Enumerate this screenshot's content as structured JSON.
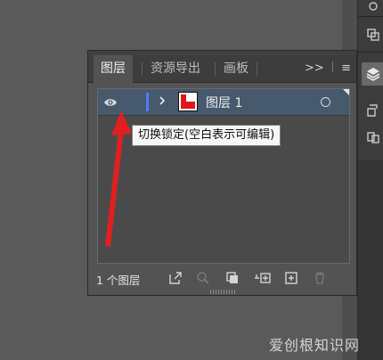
{
  "panel": {
    "tabs": [
      {
        "label": "图层"
      },
      {
        "label": "资源导出"
      },
      {
        "label": "画板"
      }
    ],
    "more_label": ">>",
    "menu_icon": "hamburger-menu-icon"
  },
  "layers": [
    {
      "name": "图层 1",
      "visible": true
    }
  ],
  "tooltip": {
    "text": "切换锁定(空白表示可编辑)"
  },
  "footer": {
    "count_label": "1 个图层"
  },
  "watermark": {
    "text": "爱创根知识网"
  },
  "colors": {
    "layer_color": "#4f7bff",
    "selected_row": "#46596d",
    "annotation_arrow": "#e02020"
  }
}
